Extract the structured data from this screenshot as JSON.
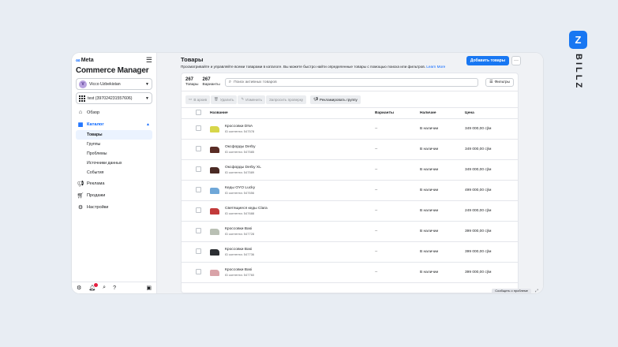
{
  "brand": {
    "logo_letter": "Z",
    "name": "BILLZ"
  },
  "sidebar": {
    "meta_logo": "Meta",
    "app_title": "Commerce Manager",
    "account": {
      "initial": "V",
      "name": "Vicco Uzbekistan"
    },
    "catalog": {
      "name": "test (397024231557606)"
    },
    "nav": {
      "overview": "Обзор",
      "catalog": "Каталог",
      "sub": [
        "Товары",
        "Группы",
        "Проблемы",
        "Источники данных",
        "События"
      ],
      "ads": "Реклама",
      "sales": "Продажи",
      "settings": "Настройки"
    }
  },
  "main": {
    "title": "Товары",
    "description": "Просматривайте и управляйте всеми товарами в каталоге. Вы можете быстро найти определенные товары с помощью поиска или фильтров.",
    "learn_more": "Learn More",
    "add_button": "Добавить товары",
    "more_button": "···",
    "stats": {
      "products_count": "267",
      "products_label": "Товары",
      "variants_count": "267",
      "variants_label": "Варианты"
    },
    "search_placeholder": "Поиск активных товаров",
    "filters_label": "Фильтры",
    "toolbar": {
      "archive": "В архив",
      "delete": "Удалить",
      "edit": "Изменить",
      "request_review": "Запросить проверку",
      "advertise": "Рекламировать группу"
    },
    "table": {
      "headers": {
        "name": "Название",
        "variants": "Варианты",
        "availability": "Наличие",
        "price": "Цена"
      },
      "rows": [
        {
          "name": "Кроссовки DNA",
          "id": "ID контента: 547578",
          "variants": "--",
          "availability": "В наличии",
          "price": "349 000,00 сўм",
          "color": "#d7d64a"
        },
        {
          "name": "Оксфорды Derby",
          "id": "ID контента: 547585",
          "variants": "--",
          "availability": "В наличии",
          "price": "349 000,00 сўм",
          "color": "#5a2d26"
        },
        {
          "name": "Оксфорды Derby XL",
          "id": "ID контента: 547589",
          "variants": "--",
          "availability": "В наличии",
          "price": "349 000,00 сўм",
          "color": "#4a2a24"
        },
        {
          "name": "Кеды OYO Lucky",
          "id": "ID контента: 547656",
          "variants": "--",
          "availability": "В наличии",
          "price": "499 000,00 сўм",
          "color": "#6fa7d8"
        },
        {
          "name": "Светящиеся кеды Clara",
          "id": "ID контента: 547688",
          "variants": "--",
          "availability": "В наличии",
          "price": "249 000,00 сўм",
          "color": "#c23a3a"
        },
        {
          "name": "Кроссовки Basi",
          "id": "ID контента: 547728",
          "variants": "--",
          "availability": "В наличии",
          "price": "399 000,00 сўм",
          "color": "#b9c0b4"
        },
        {
          "name": "Кроссовки Basi",
          "id": "ID контента: 547736",
          "variants": "--",
          "availability": "В наличии",
          "price": "399 000,00 сўм",
          "color": "#2c2f33"
        },
        {
          "name": "Кроссовки Basi",
          "id": "ID контента: 547760",
          "variants": "--",
          "availability": "В наличии",
          "price": "399 000,00 сўм",
          "color": "#d9a3a8"
        }
      ]
    },
    "report_problem": "Сообщить о проблеме"
  }
}
